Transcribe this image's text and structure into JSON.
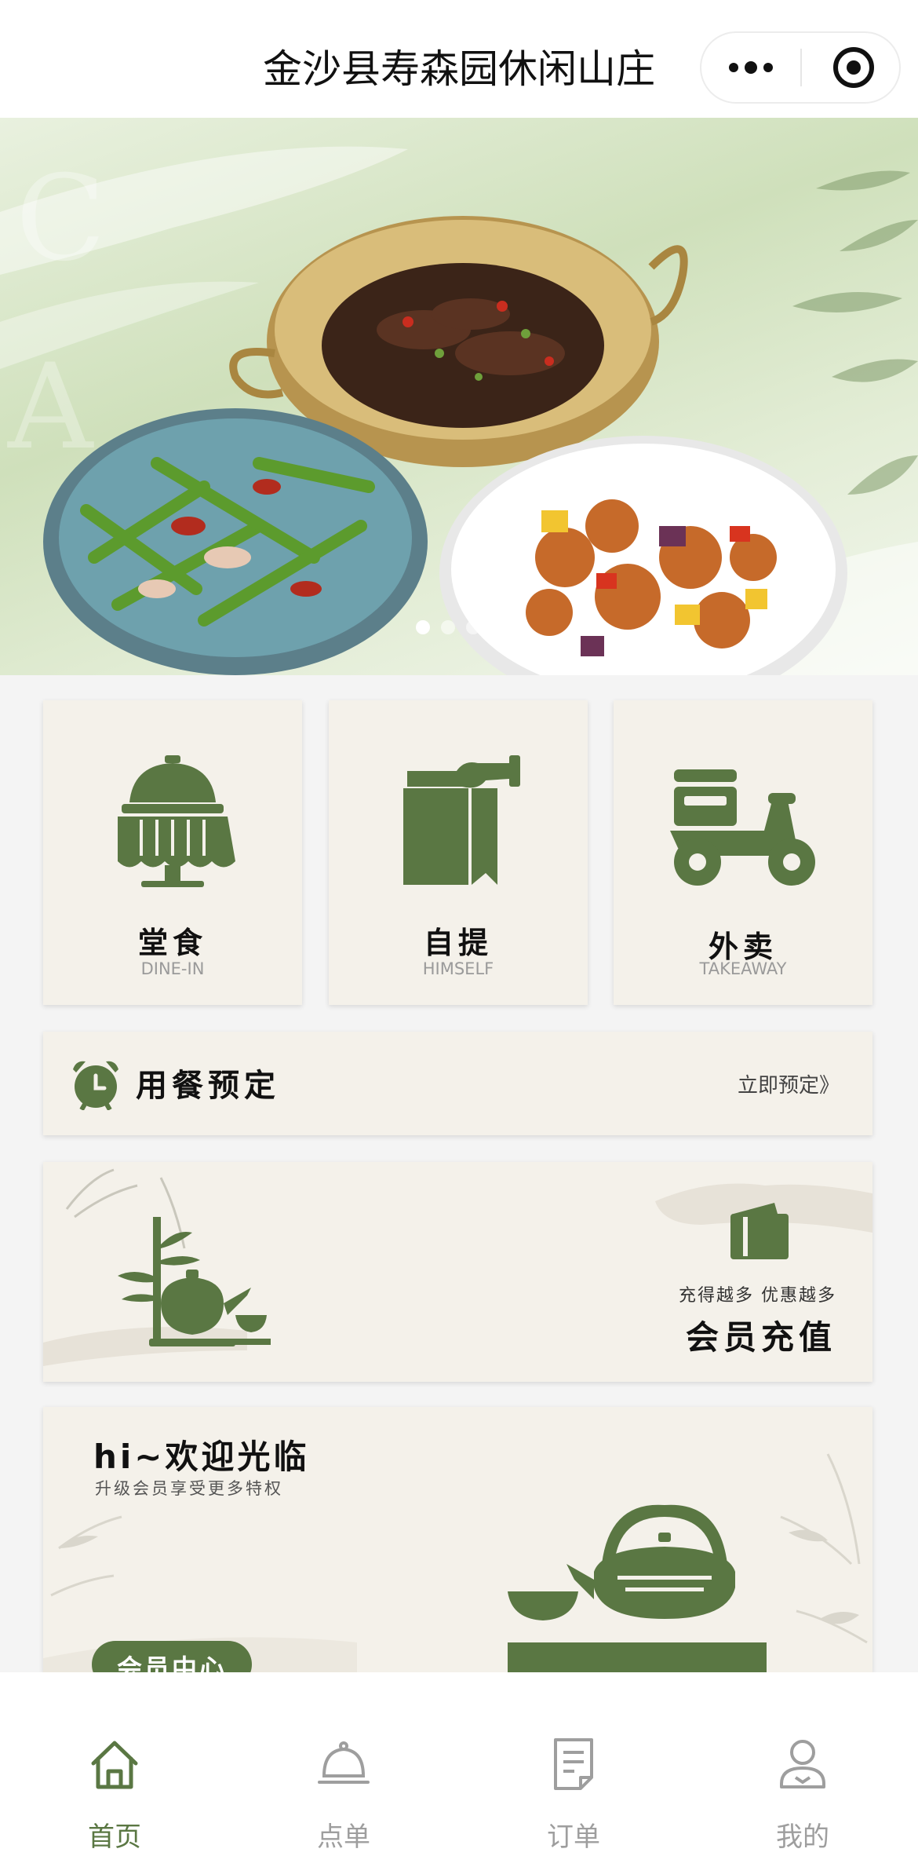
{
  "header": {
    "title": "金沙县寿森园休闲山庄"
  },
  "banner": {
    "slide_count": 3,
    "active_slide": 1
  },
  "services": [
    {
      "title": "堂食",
      "subtitle": "DINE-IN",
      "icon": "cloche-table-icon"
    },
    {
      "title": "自提",
      "subtitle": "HIMSELF",
      "icon": "takeaway-bag-icon"
    },
    {
      "title": "外卖",
      "subtitle": "TAKEAWAY",
      "icon": "scooter-icon"
    }
  ],
  "reservation": {
    "title": "用餐预定",
    "link": "立即预定》",
    "icon": "alarm-clock-icon"
  },
  "recharge": {
    "slogan": "充得越多 优惠越多",
    "title": "会员充值",
    "icon": "wallet-icon"
  },
  "welcome": {
    "title": "hi~欢迎光临",
    "subtitle": "升级会员享受更多特权",
    "button": "会员中心"
  },
  "tabbar": [
    {
      "label": "首页",
      "icon": "home-icon",
      "active": true
    },
    {
      "label": "点单",
      "icon": "cloche-icon",
      "active": false
    },
    {
      "label": "订单",
      "icon": "document-icon",
      "active": false
    },
    {
      "label": "我的",
      "icon": "user-icon",
      "active": false
    }
  ],
  "colors": {
    "accent": "#5a7743",
    "card": "#f4f1ea",
    "muted": "#9e9e9e"
  }
}
